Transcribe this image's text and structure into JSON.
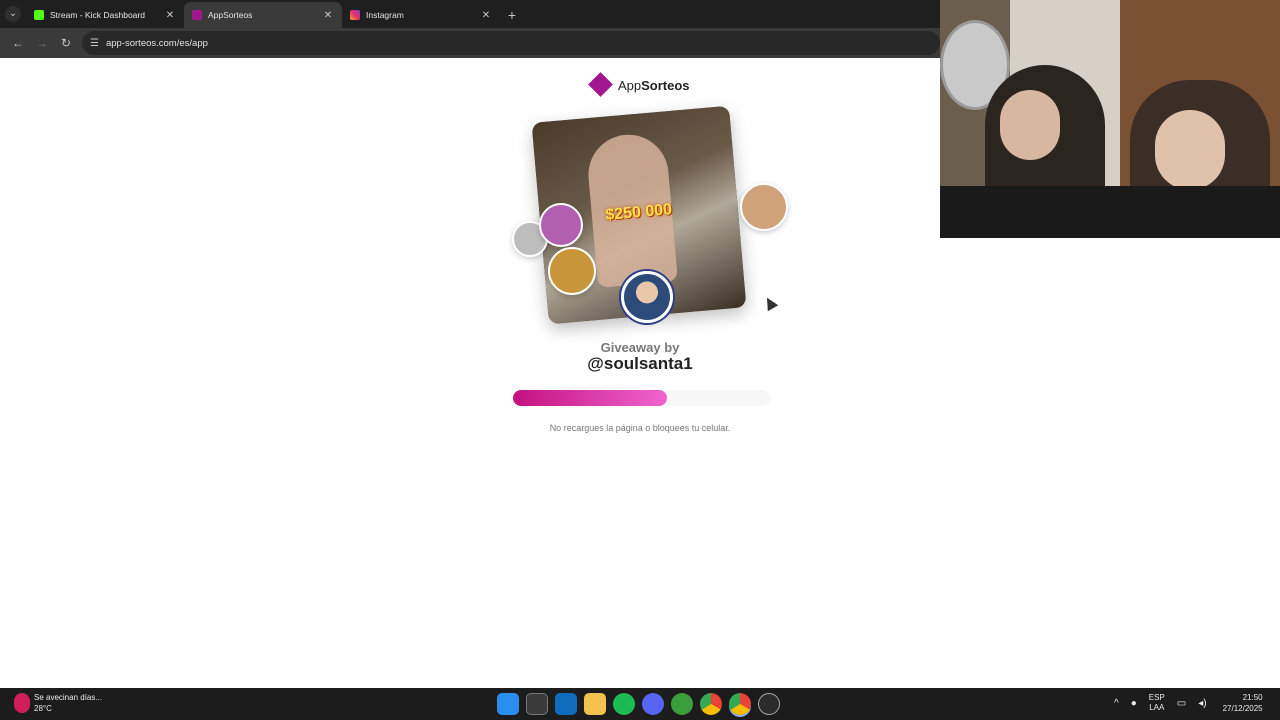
{
  "browser": {
    "tabs": [
      {
        "title": "Stream - Kick Dashboard",
        "favicon_color": "#53fc18",
        "active": false
      },
      {
        "title": "AppSorteos",
        "favicon_color": "#a0178f",
        "active": true
      },
      {
        "title": "Instagram",
        "favicon_color": "#e1306c",
        "active": false
      }
    ],
    "url": "app-sorteos.com/es/app"
  },
  "page": {
    "logo_prefix": "App",
    "logo_brand": "Sorteos",
    "card_amount": "$250 000",
    "giveaway_label": "Giveaway by",
    "host_handle": "@soulsanta1",
    "progress_fraction": 0.6,
    "hint": "No recargues la página o bloquees tu celular."
  },
  "taskbar": {
    "weather_text": "Se avecinan días...",
    "weather_temp": "28°C",
    "lang_top": "ESP",
    "lang_bottom": "LAA",
    "time": "21:50",
    "date": "27/12/2025"
  },
  "icons": {
    "tab_menu": "chevron-down-icon",
    "back": "arrow-left-icon",
    "forward": "arrow-right-icon",
    "reload": "reload-icon",
    "site_info": "tune-icon"
  }
}
